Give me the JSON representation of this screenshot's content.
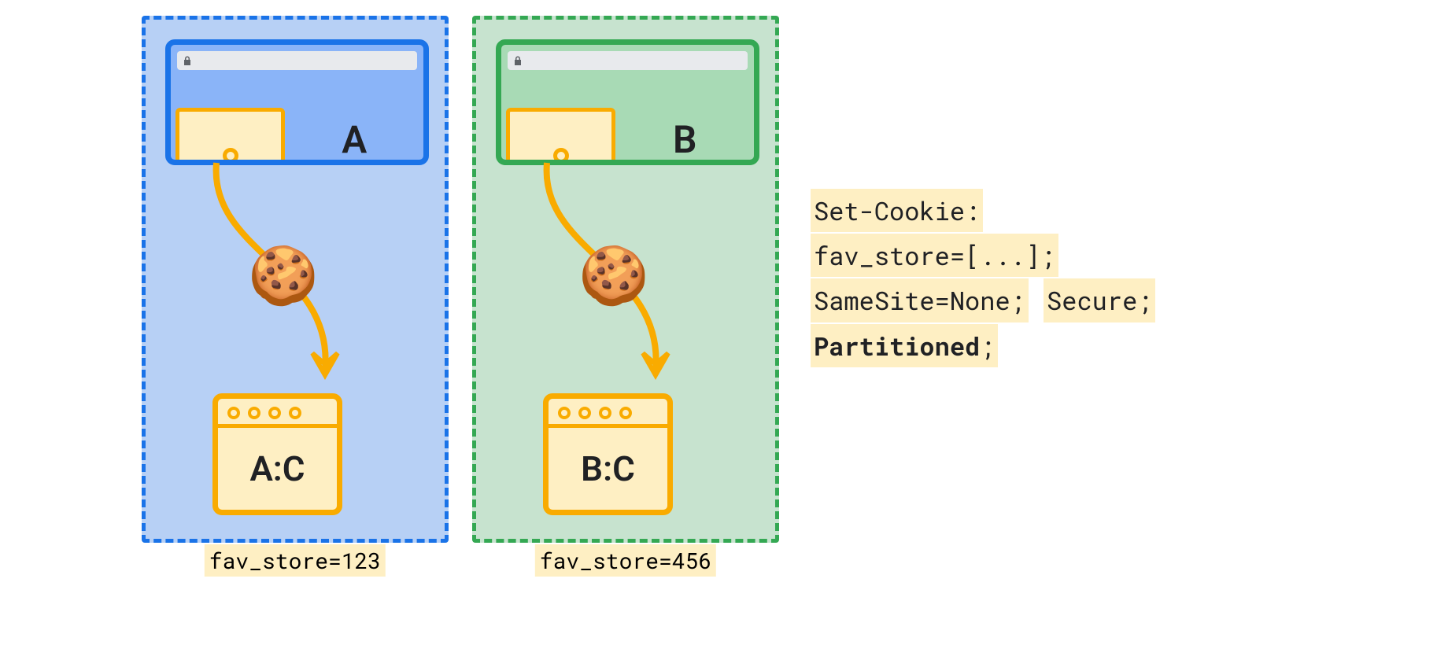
{
  "partitions": {
    "a": {
      "site_label": "A",
      "jar_label": "A:C",
      "caption": "fav_store=123"
    },
    "b": {
      "site_label": "B",
      "jar_label": "B:C",
      "caption": "fav_store=456"
    }
  },
  "header": {
    "line1": "Set-Cookie:",
    "line2": "fav_store=[...];",
    "line3a": "SameSite=None;",
    "line3b": "Secure;",
    "line4a": "Partitioned",
    "line4b": ";"
  },
  "icons": {
    "cookie": "🍪"
  }
}
